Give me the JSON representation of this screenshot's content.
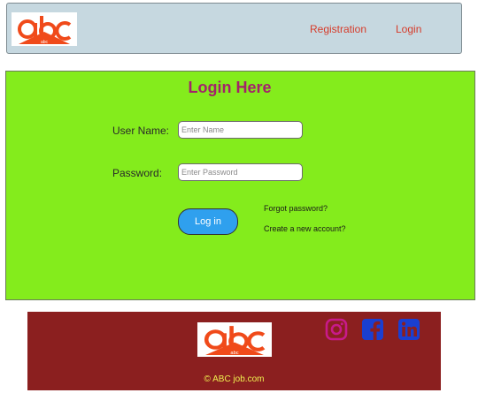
{
  "header": {
    "logo_text": "abc",
    "nav": [
      {
        "label": "Registration"
      },
      {
        "label": "Login"
      }
    ]
  },
  "login": {
    "title": "Login Here",
    "username_label": "User Name:",
    "username_placeholder": "Enter Name",
    "username_value": "",
    "password_label": "Password:",
    "password_placeholder": "Enter Password",
    "password_value": "",
    "submit_label": "Log in",
    "forgot_label": "Forgot password?",
    "create_label": "Create a new account?"
  },
  "footer": {
    "logo_text": "abc",
    "copyright": "© ABC job.com",
    "social": [
      {
        "icon": "instagram-icon",
        "color": "#c81a8a"
      },
      {
        "icon": "facebook-icon",
        "color": "#1a3fd1"
      },
      {
        "icon": "linkedin-icon",
        "color": "#1a3fd1"
      }
    ]
  },
  "colors": {
    "header_bg": "#c6d8e0",
    "panel_bg": "#84ec1c",
    "footer_bg": "#8b1f1f",
    "accent_title": "#a3226a",
    "nav_link": "#d63b2a",
    "button": "#2fa0ee",
    "logo": "#f04a1a"
  }
}
